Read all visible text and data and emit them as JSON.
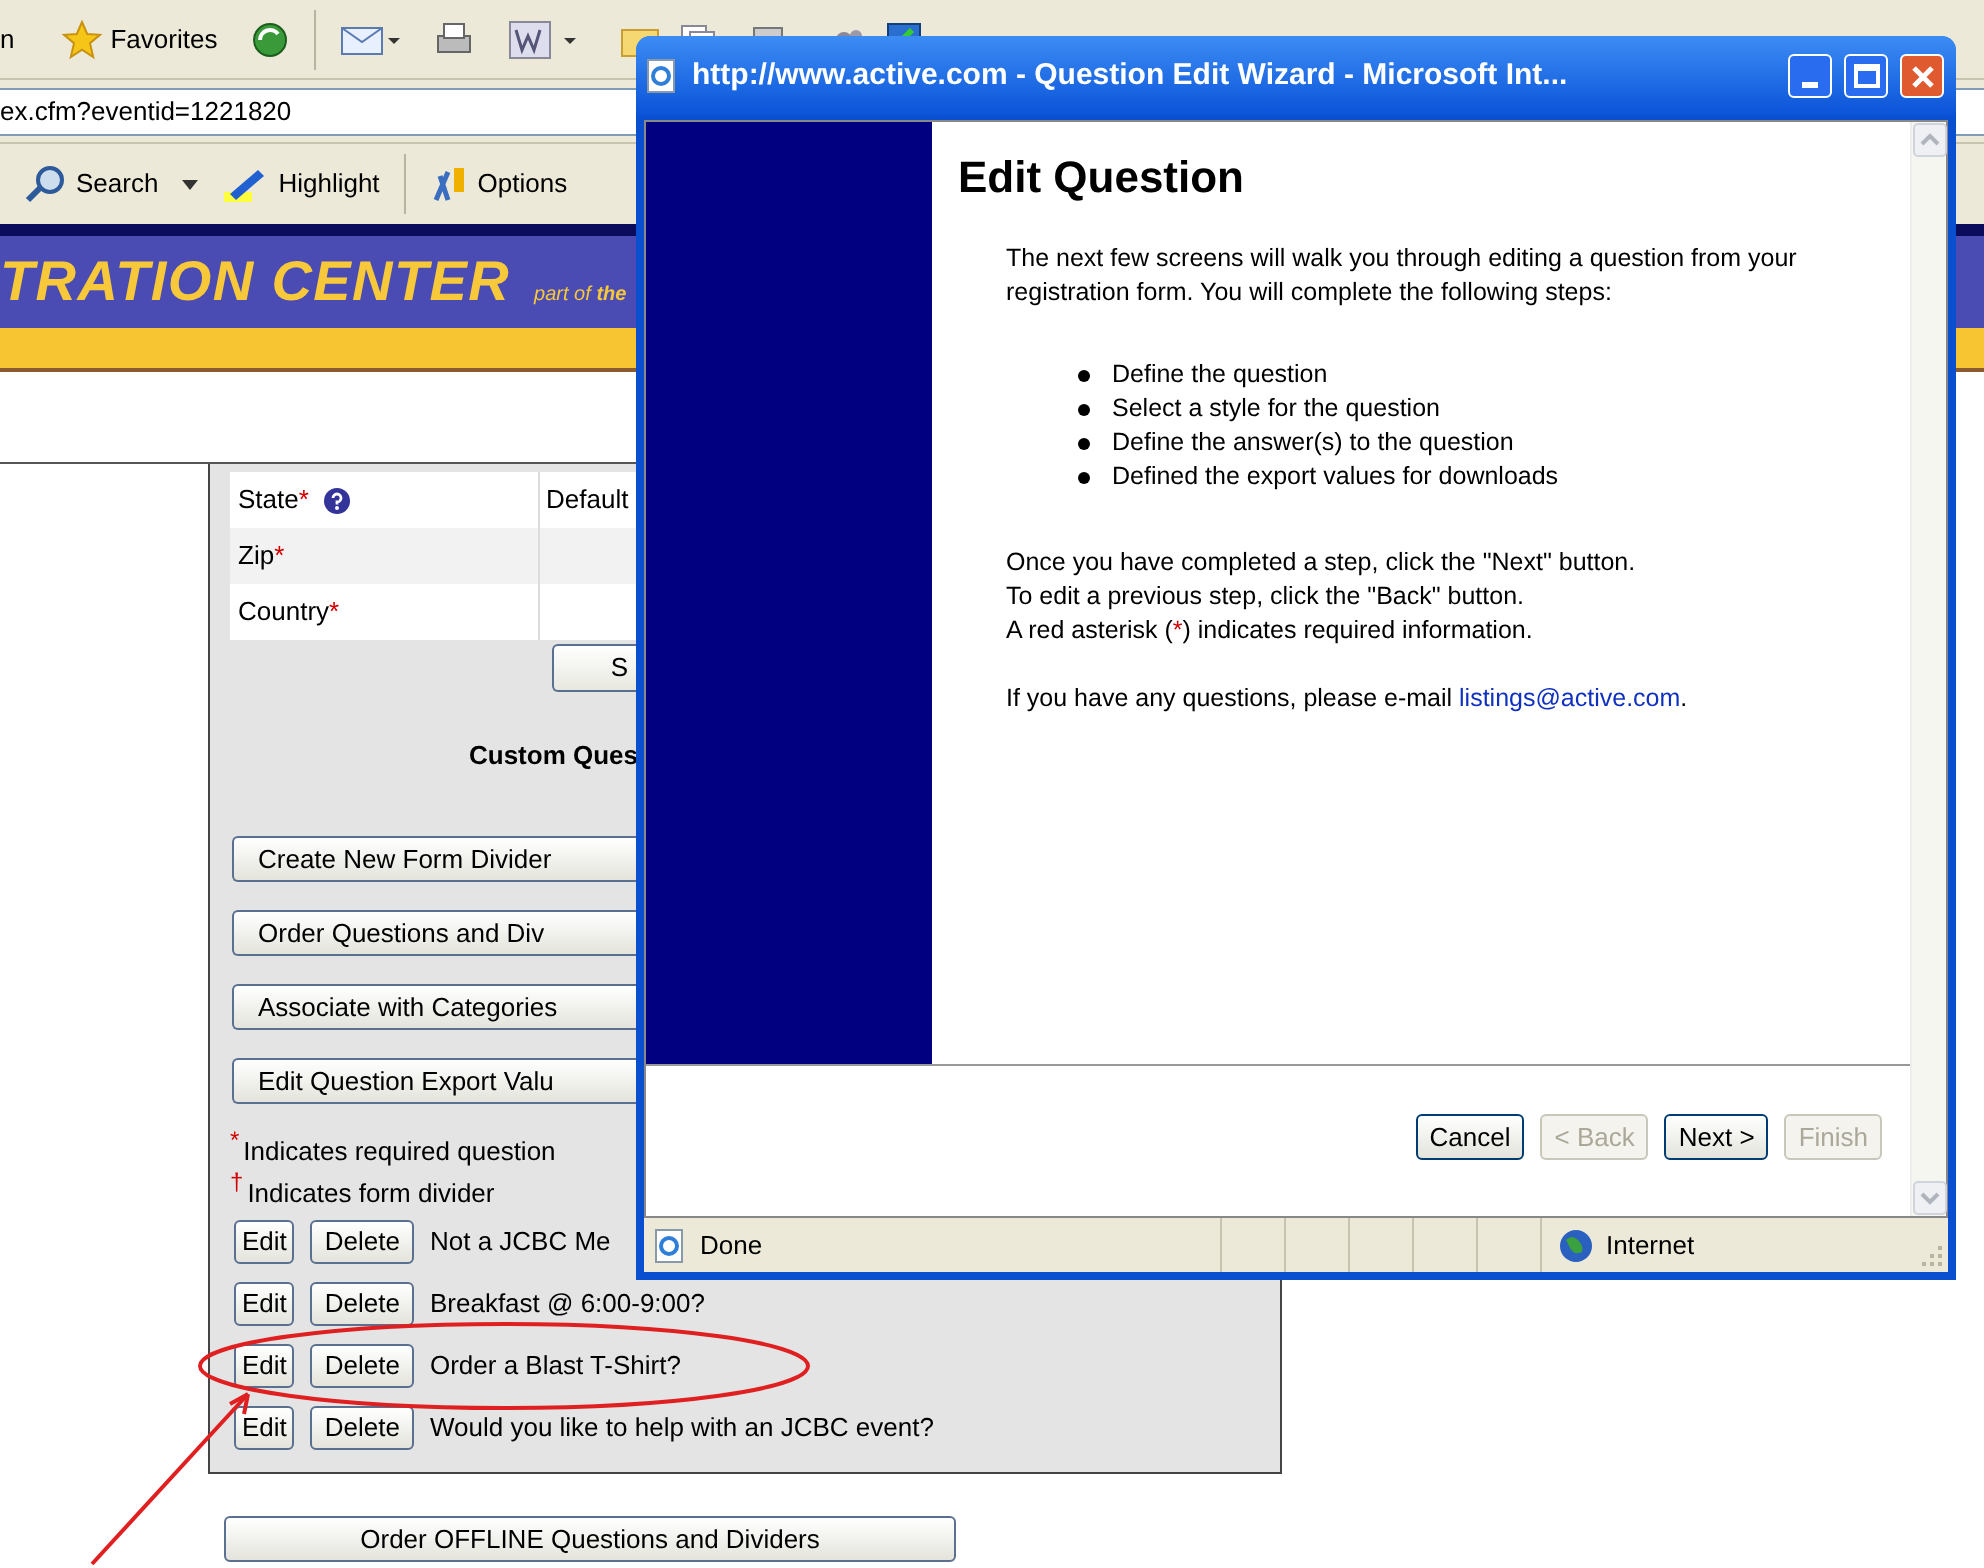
{
  "browser_toolbar": {
    "cut_label": "n",
    "favorites": "Favorites"
  },
  "address": "ex.cfm?eventid=1221820",
  "links_toolbar": [
    {
      "kind": "search",
      "label": "Search",
      "dropdown": true
    },
    {
      "kind": "highlight",
      "label": "Highlight",
      "dropdown": false
    },
    {
      "kind": "options",
      "label": "Options",
      "dropdown": false
    }
  ],
  "banner": {
    "title": "TRATION CENTER",
    "tagline": "part of **the**"
  },
  "address_table": [
    {
      "label": "State",
      "required_mark": "*",
      "help": true,
      "value": "Default"
    },
    {
      "label": "Zip",
      "required_mark": "*",
      "help": false
    },
    {
      "label": "Country",
      "required_mark": "*",
      "help": false
    }
  ],
  "submit_button": "S",
  "custom_questions": {
    "heading": "Custom Ques",
    "actions": [
      "Create New Form Divider",
      "Order Questions and Div",
      "Associate with Categories",
      "Edit Question Export Valu"
    ],
    "legend": [
      {
        "mark": "*",
        "text": "Indicates required question"
      },
      {
        "mark": "†",
        "text": "Indicates form divider"
      }
    ],
    "questions": [
      {
        "edit": "Edit",
        "delete": "Delete",
        "text": "Not a JCBC Me",
        "circled": false
      },
      {
        "edit": "Edit",
        "delete": "Delete",
        "text": "Breakfast @ 6:00-9:00?",
        "circled": false
      },
      {
        "edit": "Edit",
        "delete": "Delete",
        "text": "Order a Blast T-Shirt?",
        "circled": true
      },
      {
        "edit": "Edit",
        "delete": "Delete",
        "text": "Would you like to help with an JCBC event?",
        "circled": false
      }
    ],
    "offline_button": "Order OFFLINE Questions and Dividers"
  },
  "popup": {
    "title": "http://www.active.com - Question Edit Wizard - Microsoft Int...",
    "heading": "Edit Question",
    "intro": "The next few screens will walk you through editing a question from your registration form. You will complete the following steps:",
    "steps": [
      "Define the question",
      "Select a style for the question",
      "Define the answer(s) to the question",
      "Defined the export values for downloads"
    ],
    "instructions": [
      "Once you have completed a step, click the \"Next\" button.",
      "To edit a previous step, click the \"Back\" button."
    ],
    "required_note": {
      "before": "A red asterisk (",
      "mark": "*",
      "after": ") indicates required information."
    },
    "contact": {
      "text": "If you have any questions, please e-mail ",
      "link": "listings@active.com",
      "after": "."
    },
    "buttons": [
      {
        "label": "Cancel",
        "disabled": false
      },
      {
        "label": "< Back",
        "disabled": true
      },
      {
        "label": "Next >",
        "disabled": false
      },
      {
        "label": "Finish",
        "disabled": true
      }
    ],
    "status": "Done",
    "zone": "Internet"
  }
}
